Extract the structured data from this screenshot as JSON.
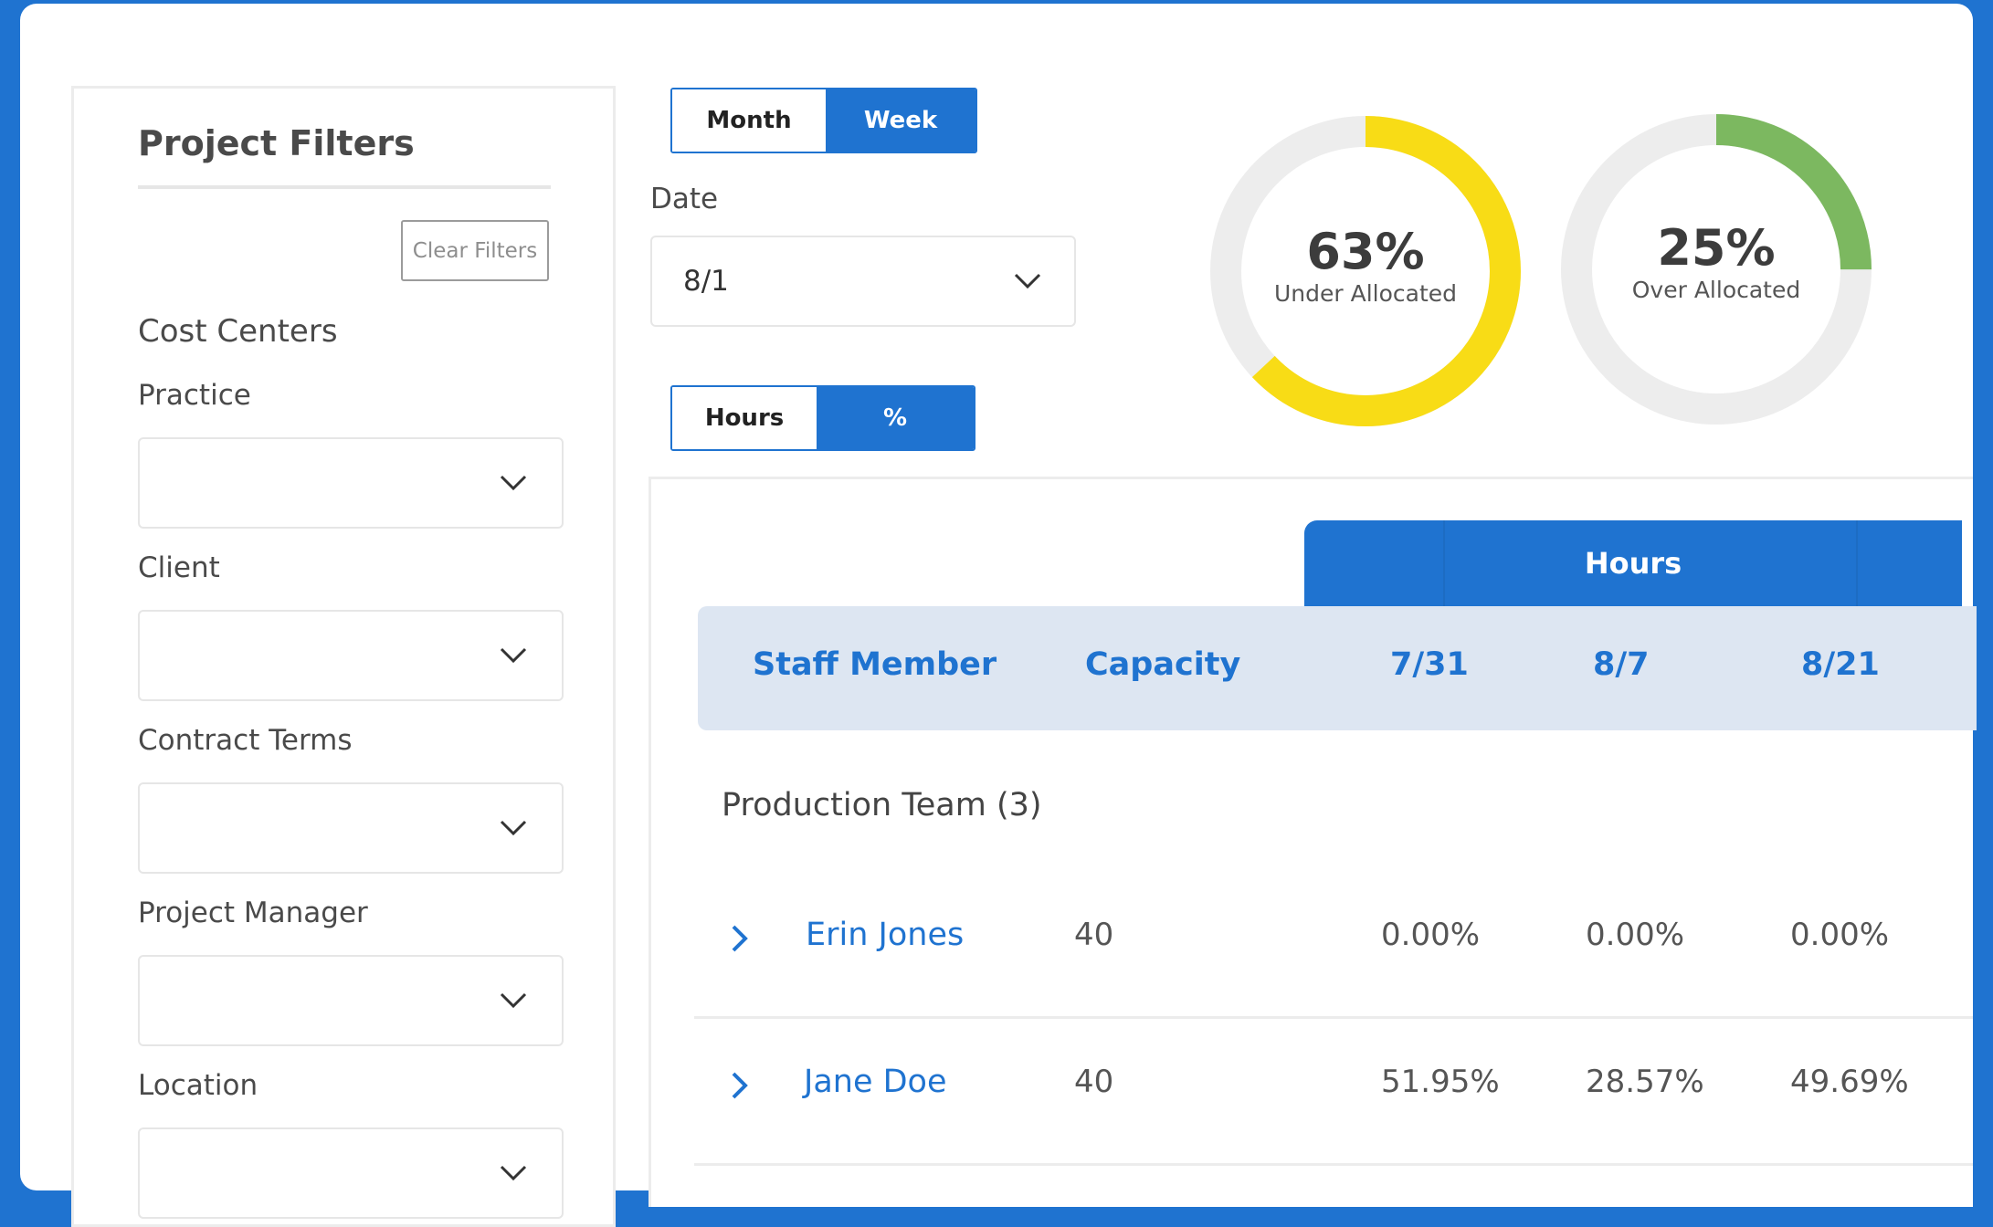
{
  "colors": {
    "brand_blue": "#1f73d0",
    "under_allocated": "#f8dc16",
    "over_allocated": "#7cb860",
    "donut_track": "#ededed",
    "header_bg": "#dde6f2"
  },
  "filters": {
    "title": "Project Filters",
    "clear_label": "Clear Filters",
    "section_title": "Cost Centers",
    "fields": [
      {
        "label": "Practice",
        "value": ""
      },
      {
        "label": "Client",
        "value": ""
      },
      {
        "label": "Contract Terms",
        "value": ""
      },
      {
        "label": "Project Manager",
        "value": ""
      },
      {
        "label": "Location",
        "value": ""
      }
    ]
  },
  "period_toggle": {
    "options": [
      "Month",
      "Week"
    ],
    "selected": "Week"
  },
  "date": {
    "label": "Date",
    "value": "8/1"
  },
  "unit_toggle": {
    "options": [
      "Hours",
      "%"
    ],
    "selected": "%"
  },
  "allocation": {
    "under": {
      "pct_text": "63%",
      "caption": "Under Allocated",
      "value": 63
    },
    "over": {
      "pct_text": "25%",
      "caption": "Over Allocated",
      "value": 25
    }
  },
  "table": {
    "band_label": "Hours",
    "columns": [
      "Staff Member",
      "Capacity",
      "7/31",
      "8/7",
      "8/21"
    ],
    "group": "Production Team (3)",
    "rows": [
      {
        "name": "Erin Jones",
        "capacity": "40",
        "c1": "0.00%",
        "c2": "0.00%",
        "c3": "0.00%"
      },
      {
        "name": "Jane Doe",
        "capacity": "40",
        "c1": "51.95%",
        "c2": "28.57%",
        "c3": "49.69%"
      }
    ]
  }
}
